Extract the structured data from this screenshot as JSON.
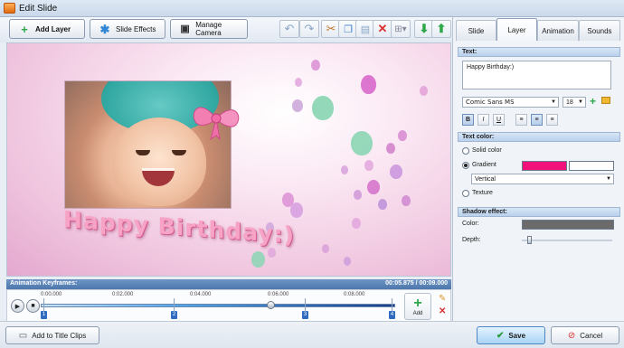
{
  "window": {
    "title": "Edit Slide"
  },
  "toolbar": {
    "add_layer": "Add Layer",
    "slide_effects": "Slide Effects",
    "manage_camera": "Manage Camera",
    "icons": [
      "undo-icon",
      "redo-icon",
      "cut-icon",
      "copy-icon",
      "paste-icon",
      "delete-icon",
      "grid-icon",
      "move-down-icon",
      "move-up-icon"
    ]
  },
  "preview": {
    "caption": "Happy Birthday:)"
  },
  "keyframes": {
    "header": "Animation Keyframes:",
    "time_display": "00:05.875 / 00:09.000",
    "ticks": [
      "0:00.000",
      "0:02.000",
      "0:04.000",
      "0:06.000",
      "0:08.000"
    ],
    "markers": [
      "1",
      "2",
      "3",
      "4"
    ],
    "add_label": "Add"
  },
  "tabs": [
    "Slide",
    "Layer",
    "Animation",
    "Sounds"
  ],
  "active_tab": "Layer",
  "text_section": {
    "header": "Text:",
    "value": "Happy Birthday:)",
    "font": "Comic Sans MS",
    "size": "18",
    "format_buttons": [
      "B",
      "I",
      "U"
    ]
  },
  "text_color": {
    "header": "Text color:",
    "options": [
      "Solid color",
      "Gradient",
      "Texture"
    ],
    "selected": "Gradient",
    "gradient_color_1": "#f0127a",
    "gradient_color_2": "#ffffff",
    "gradient_direction": "Vertical"
  },
  "shadow": {
    "header": "Shadow effect:",
    "color_label": "Color:",
    "color": "#6b6b6b",
    "depth_label": "Depth:",
    "depth_level": 0.05
  },
  "bottom": {
    "add_to_title_clips": "Add to Title Clips",
    "save": "Save",
    "cancel": "Cancel"
  }
}
